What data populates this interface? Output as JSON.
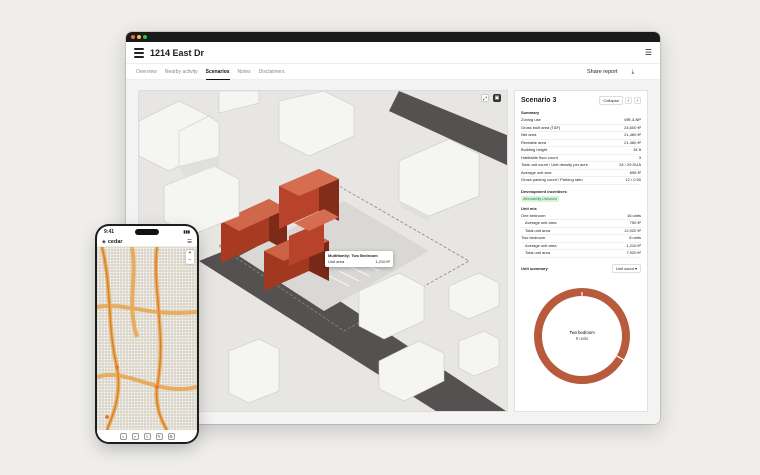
{
  "window": {
    "title": "1214 East Dr",
    "menu_icon": "hamburger-icon"
  },
  "tabs": [
    "Overview",
    "Nearby activity",
    "Scenarios",
    "Notes",
    "Disclaimers"
  ],
  "active_tab": "Scenarios",
  "share_label": "Share report",
  "tooltip": {
    "title": "Multifamily: Two Bedroom",
    "label": "Unit area",
    "value": "1,210 ft²"
  },
  "scenario": {
    "title": "Scenario 3",
    "collapse": "Collapse",
    "summary_title": "Summary",
    "summary": [
      {
        "label": "Zoning use",
        "value": "MR-3-NP"
      },
      {
        "label": "Gross built area (TAF)",
        "value": "24,600 ft²"
      },
      {
        "label": "Net area",
        "value": "21,460 ft²"
      },
      {
        "label": "Rentable area",
        "value": "21,460 ft²"
      },
      {
        "label": "Building height",
        "value": "34 ft"
      },
      {
        "label": "Habitable floor count",
        "value": "3"
      },
      {
        "label": "Total unit count / Unit density per acre",
        "value": "24 / 29 DUA"
      },
      {
        "label": "Average unit size",
        "value": "895 ft²"
      },
      {
        "label": "Gross parking count / Parking ratio",
        "value": "12 / 0.50"
      }
    ],
    "incentives_title": "Development incentives",
    "incentive_badge": "Affordability Unlocked",
    "unit_mix_title": "Unit mix",
    "unit_mix": [
      {
        "label": "One bedroom",
        "value": "16 units"
      },
      {
        "label": "Average unit area",
        "value": "750 ft²",
        "indent": true
      },
      {
        "label": "Total unit area",
        "value": "12,020 ft²",
        "indent": true
      },
      {
        "label": "Two bedroom",
        "value": "8 units"
      },
      {
        "label": "Average unit area",
        "value": "1,210 ft²",
        "indent": true
      },
      {
        "label": "Total unit area",
        "value": "7,920 ft²",
        "indent": true
      }
    ],
    "unit_summary_title": "Unit summary",
    "unit_summary_select": "Unit count",
    "donut_label": "Two bedroom",
    "donut_value": "8 units",
    "donut_fraction": 0.333,
    "donut_color": "#b85a3c"
  },
  "phone": {
    "time": "9:41",
    "brand": "cedar",
    "menu_icon": "hamburger-icon"
  },
  "colors": {
    "accent": "#c94a30",
    "building": "#bf4a2d"
  }
}
